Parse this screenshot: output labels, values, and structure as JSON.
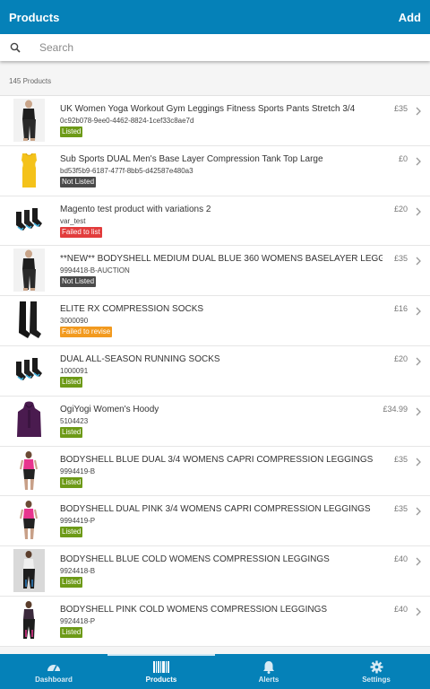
{
  "header": {
    "title": "Products",
    "add_label": "Add"
  },
  "search": {
    "placeholder": "Search",
    "value": ""
  },
  "summary": {
    "count_text": "145 Products"
  },
  "colors": {
    "brand": "#0581b8",
    "listed": "#6d9a17",
    "not_listed": "#4a4a4a",
    "failed_to_list": "#e23c3c",
    "failed_to_revise": "#f29a1f"
  },
  "products": [
    {
      "name": "UK Women Yoga Workout Gym Leggings Fitness Sports Pants Stretch 3/4",
      "sku": "0c92b078-9ee0-4462-8824-1cef33c8ae7d",
      "status": "Listed",
      "status_key": "listed",
      "price": "£35",
      "thumb_icon": "leggings-photo"
    },
    {
      "name": "Sub Sports DUAL Men's Base Layer Compression Tank Top Large",
      "sku": "bd53f5b9-6187-477f-8bb5-d42587e480a3",
      "status": "Not Listed",
      "status_key": "not_listed",
      "price": "£0",
      "thumb_icon": "tank-top-photo"
    },
    {
      "name": "Magento test product with variations 2",
      "sku": "var_test",
      "status": "Failed to list",
      "status_key": "failed_to_list",
      "price": "£20",
      "thumb_icon": "socks-photo"
    },
    {
      "name": "**NEW** BODYSHELL MEDIUM DUAL BLUE 360 WOMENS BASELAYER LEGGINGS",
      "sku": "9994418-B-AUCTION",
      "status": "Not Listed",
      "status_key": "not_listed",
      "price": "£35",
      "thumb_icon": "leggings-photo"
    },
    {
      "name": "ELITE RX COMPRESSION SOCKS",
      "sku": "3000090",
      "status": "Failed to revise",
      "status_key": "failed_to_revise",
      "price": "£16",
      "thumb_icon": "compression-socks-photo"
    },
    {
      "name": "DUAL ALL-SEASON RUNNING SOCKS",
      "sku": "1000091",
      "status": "Listed",
      "status_key": "listed",
      "price": "£20",
      "thumb_icon": "socks-photo"
    },
    {
      "name": "OgiYogi Women's Hoody",
      "sku": "5104423",
      "status": "Listed",
      "status_key": "listed",
      "price": "£34.99",
      "thumb_icon": "hoody-photo"
    },
    {
      "name": "BODYSHELL BLUE DUAL 3/4 WOMENS CAPRI COMPRESSION LEGGINGS",
      "sku": "9994419-B",
      "status": "Listed",
      "status_key": "listed",
      "price": "£35",
      "thumb_icon": "model-pink-photo"
    },
    {
      "name": "BODYSHELL DUAL PINK 3/4 WOMENS CAPRI COMPRESSION LEGGINGS",
      "sku": "9994419-P",
      "status": "Listed",
      "status_key": "listed",
      "price": "£35",
      "thumb_icon": "model-pink-photo"
    },
    {
      "name": "BODYSHELL BLUE COLD WOMENS COMPRESSION LEGGINGS",
      "sku": "9924418-B",
      "status": "Listed",
      "status_key": "listed",
      "price": "£40",
      "thumb_icon": "model-grey-photo"
    },
    {
      "name": "BODYSHELL PINK COLD WOMENS COMPRESSION LEGGINGS",
      "sku": "9924418-P",
      "status": "Listed",
      "status_key": "listed",
      "price": "£40",
      "thumb_icon": "model-dark-photo"
    }
  ],
  "tabs": [
    {
      "label": "Dashboard",
      "icon": "dashboard-gauge-icon",
      "active": false
    },
    {
      "label": "Products",
      "icon": "barcode-icon",
      "active": true
    },
    {
      "label": "Alerts",
      "icon": "bell-icon",
      "active": false
    },
    {
      "label": "Settings",
      "icon": "gear-icon",
      "active": false
    }
  ]
}
